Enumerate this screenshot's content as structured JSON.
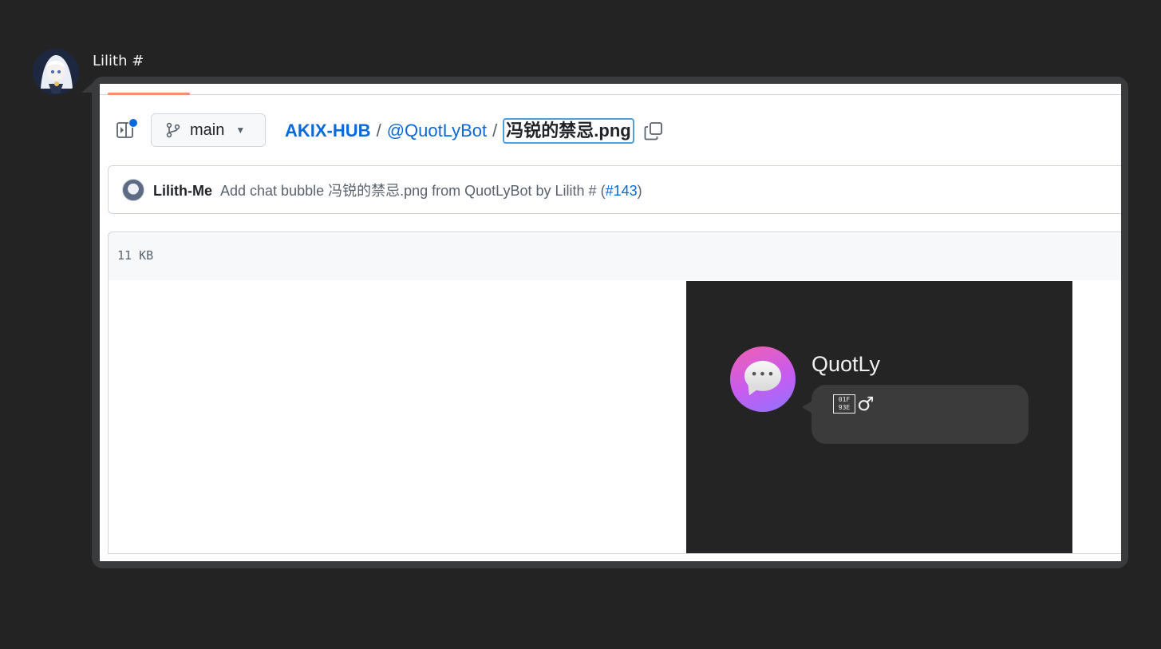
{
  "message": {
    "sender": "Lilith #",
    "avatar_icon": "anime-avatar-icon"
  },
  "github": {
    "branch": "main",
    "breadcrumb": {
      "repo": "AKIX-HUB",
      "separator": "/",
      "dir": "@QuotLyBot",
      "file": "冯锐的禁忌.png"
    },
    "commit": {
      "author": "Lilith-Me",
      "message_prefix": "Add chat bubble 冯锐的禁忌.png from QuotLyBot by Lilith # (",
      "pr": "#143",
      "message_suffix": ")"
    },
    "file_size": "11 KB",
    "accent_color": "#0969da"
  },
  "preview": {
    "name": "QuotLy",
    "tofu_glyph": "01F 93E",
    "text_suffix": "♂",
    "avatar_icon": "speech-bubble-icon"
  }
}
